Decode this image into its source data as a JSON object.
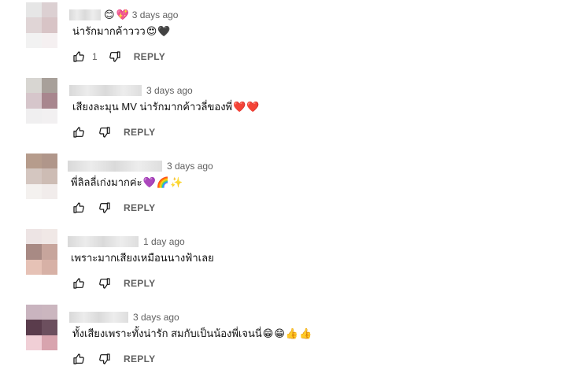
{
  "comments": [
    {
      "timestamp": "3 days ago",
      "badges": [
        "😊",
        "💖"
      ],
      "text": "น่ารักมากค้าววว",
      "emojis": [
        "😍",
        "🖤"
      ],
      "like_count": "1",
      "reply_label": "REPLY",
      "avatar_colors": [
        "#e6e6e6",
        "#dcd0d2",
        "#e0d5d6",
        "#d8c4c6",
        "#f2f2f2",
        "#f5f0f1"
      ]
    },
    {
      "timestamp": "3 days ago",
      "badges": [],
      "text": "เสียงละมุน MV น่ารักมากค้าวลี่ของพี่",
      "emojis": [
        "❤️",
        "❤️"
      ],
      "like_count": "",
      "reply_label": "REPLY",
      "avatar_colors": [
        "#d8d6d2",
        "#a8a09a",
        "#d6c6cb",
        "#a8868e",
        "#f0eff0",
        "#f2f0f1"
      ]
    },
    {
      "timestamp": "3 days ago",
      "badges": [],
      "text": "พี่ลิลลี่เก่งมากค่ะ",
      "emojis": [
        "💜",
        "🌈",
        "✨"
      ],
      "like_count": "",
      "reply_label": "REPLY",
      "avatar_colors": [
        "#b69c8c",
        "#b0968a",
        "#d4c6c0",
        "#cdbcb4",
        "#f4f1ef",
        "#f1eceb"
      ]
    },
    {
      "timestamp": "1 day ago",
      "badges": [],
      "text": "เพราะมากเสียงเหมือนนางฟ้าเลย",
      "emojis": [],
      "like_count": "",
      "reply_label": "REPLY",
      "avatar_colors": [
        "#ede4e4",
        "#f0e8e6",
        "#a88a84",
        "#c7a59c",
        "#e6c2b6",
        "#d7b1a6"
      ]
    },
    {
      "timestamp": "3 days ago",
      "badges": [],
      "text": "ทั้งเสียงเพราะทั้งน่ารัก สมกับเป็นน้องพี่เจนนี่",
      "emojis": [
        "😁",
        "😁",
        "👍",
        "👍"
      ],
      "like_count": "",
      "reply_label": "REPLY",
      "avatar_colors": [
        "#c9b4bf",
        "#cbb6bf",
        "#5a3c4c",
        "#6c4f5e",
        "#f0cfd6",
        "#d8a4ae"
      ]
    }
  ],
  "icons": {
    "like": "thumb-up-icon",
    "dislike": "thumb-down-icon"
  },
  "colors": {
    "text_primary": "#0f0f0f",
    "text_secondary": "#606060",
    "background": "#ffffff"
  }
}
